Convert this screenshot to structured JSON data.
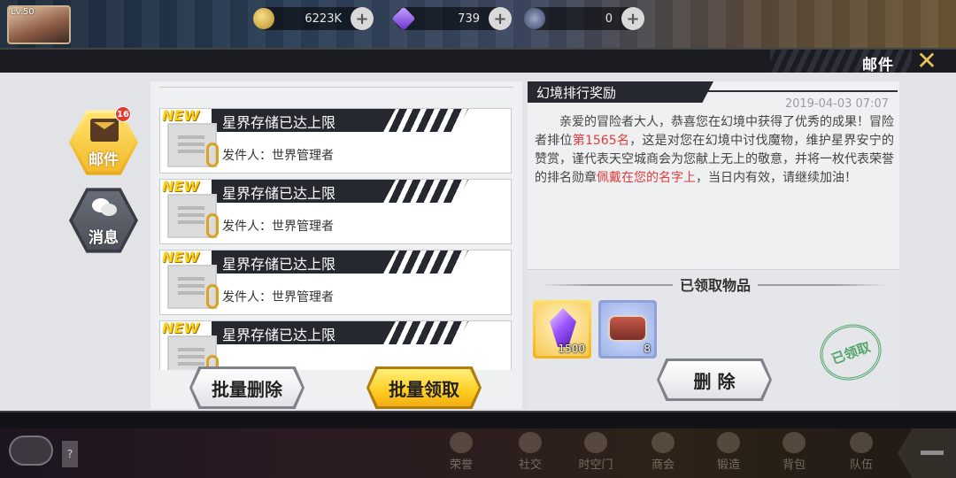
{
  "player": {
    "level": "Lv.50"
  },
  "resources": {
    "gold": "6223K",
    "gems": "739",
    "other": "0",
    "plus": "+"
  },
  "header": {
    "title": "邮件",
    "close_icon": "close-x-icon"
  },
  "tabs": [
    {
      "label": "邮件",
      "badge": "16",
      "icon": "envelope-icon"
    },
    {
      "label": "消息",
      "icon": "chat-icon"
    }
  ],
  "mail_list": [
    {
      "tag": "NEW",
      "title": "星界存储已达上限",
      "sender": "发件人：世界管理者"
    },
    {
      "tag": "NEW",
      "title": "星界存储已达上限",
      "sender": "发件人：世界管理者"
    },
    {
      "tag": "NEW",
      "title": "星界存储已达上限",
      "sender": "发件人：世界管理者"
    },
    {
      "tag": "NEW",
      "title": "星界存储已达上限",
      "sender": ""
    }
  ],
  "buttons": {
    "batch_delete": "批量删除",
    "batch_claim": "批量领取",
    "delete": "删 除"
  },
  "detail": {
    "title": "幻境排行奖励",
    "date": "2019-04-03 07:07",
    "body_1": "亲爱的冒险者大人，恭喜您在幻境中获得了优秀的成果！冒险者排位",
    "rank": "第1565名",
    "body_2": "，这是对您在幻境中讨伐魔物，维护星界安宁的赞赏，谨代表天空城商会为您献上无上的敬意，并将一枚代表荣誉的排名勋章",
    "highlight": "佩戴在您的名字上",
    "body_3": "，当日内有效，请继续加油！"
  },
  "items": {
    "header": "已领取物品",
    "list": [
      {
        "name": "crystal-icon",
        "count": "1500"
      },
      {
        "name": "belt-icon",
        "count": "8"
      }
    ],
    "stamp": "已领取"
  },
  "bottom_nav": {
    "question": "?",
    "items": [
      "荣誉",
      "社交",
      "时空门",
      "商会",
      "锻造",
      "背包",
      "队伍"
    ]
  }
}
